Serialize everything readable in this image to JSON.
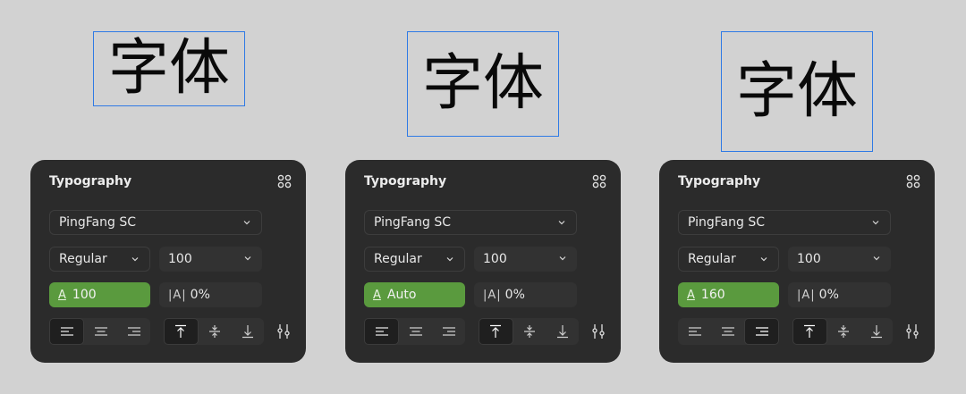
{
  "colors": {
    "background": "#d2d2d2",
    "panel": "#2b2b2b",
    "selection_outline": "#2f7ae5",
    "active_green": "#5a9a3e"
  },
  "variants": [
    {
      "sample_text": "字体",
      "panel": {
        "title": "Typography",
        "font_family": "PingFang SC",
        "font_weight": "Regular",
        "font_size": "100",
        "line_height_icon": "A",
        "line_height": "100",
        "letter_spacing_icon": "|A|",
        "letter_spacing": "0%",
        "text_align_selected": "left",
        "vertical_align_selected": "top"
      }
    },
    {
      "sample_text": "字体",
      "panel": {
        "title": "Typography",
        "font_family": "PingFang SC",
        "font_weight": "Regular",
        "font_size": "100",
        "line_height_icon": "A",
        "line_height": "Auto",
        "letter_spacing_icon": "|A|",
        "letter_spacing": "0%",
        "text_align_selected": "left",
        "vertical_align_selected": "top"
      }
    },
    {
      "sample_text": "字体",
      "panel": {
        "title": "Typography",
        "font_family": "PingFang SC",
        "font_weight": "Regular",
        "font_size": "100",
        "line_height_icon": "A",
        "line_height": "160",
        "letter_spacing_icon": "|A|",
        "letter_spacing": "0%",
        "text_align_selected": "right",
        "vertical_align_selected": "top"
      }
    }
  ]
}
